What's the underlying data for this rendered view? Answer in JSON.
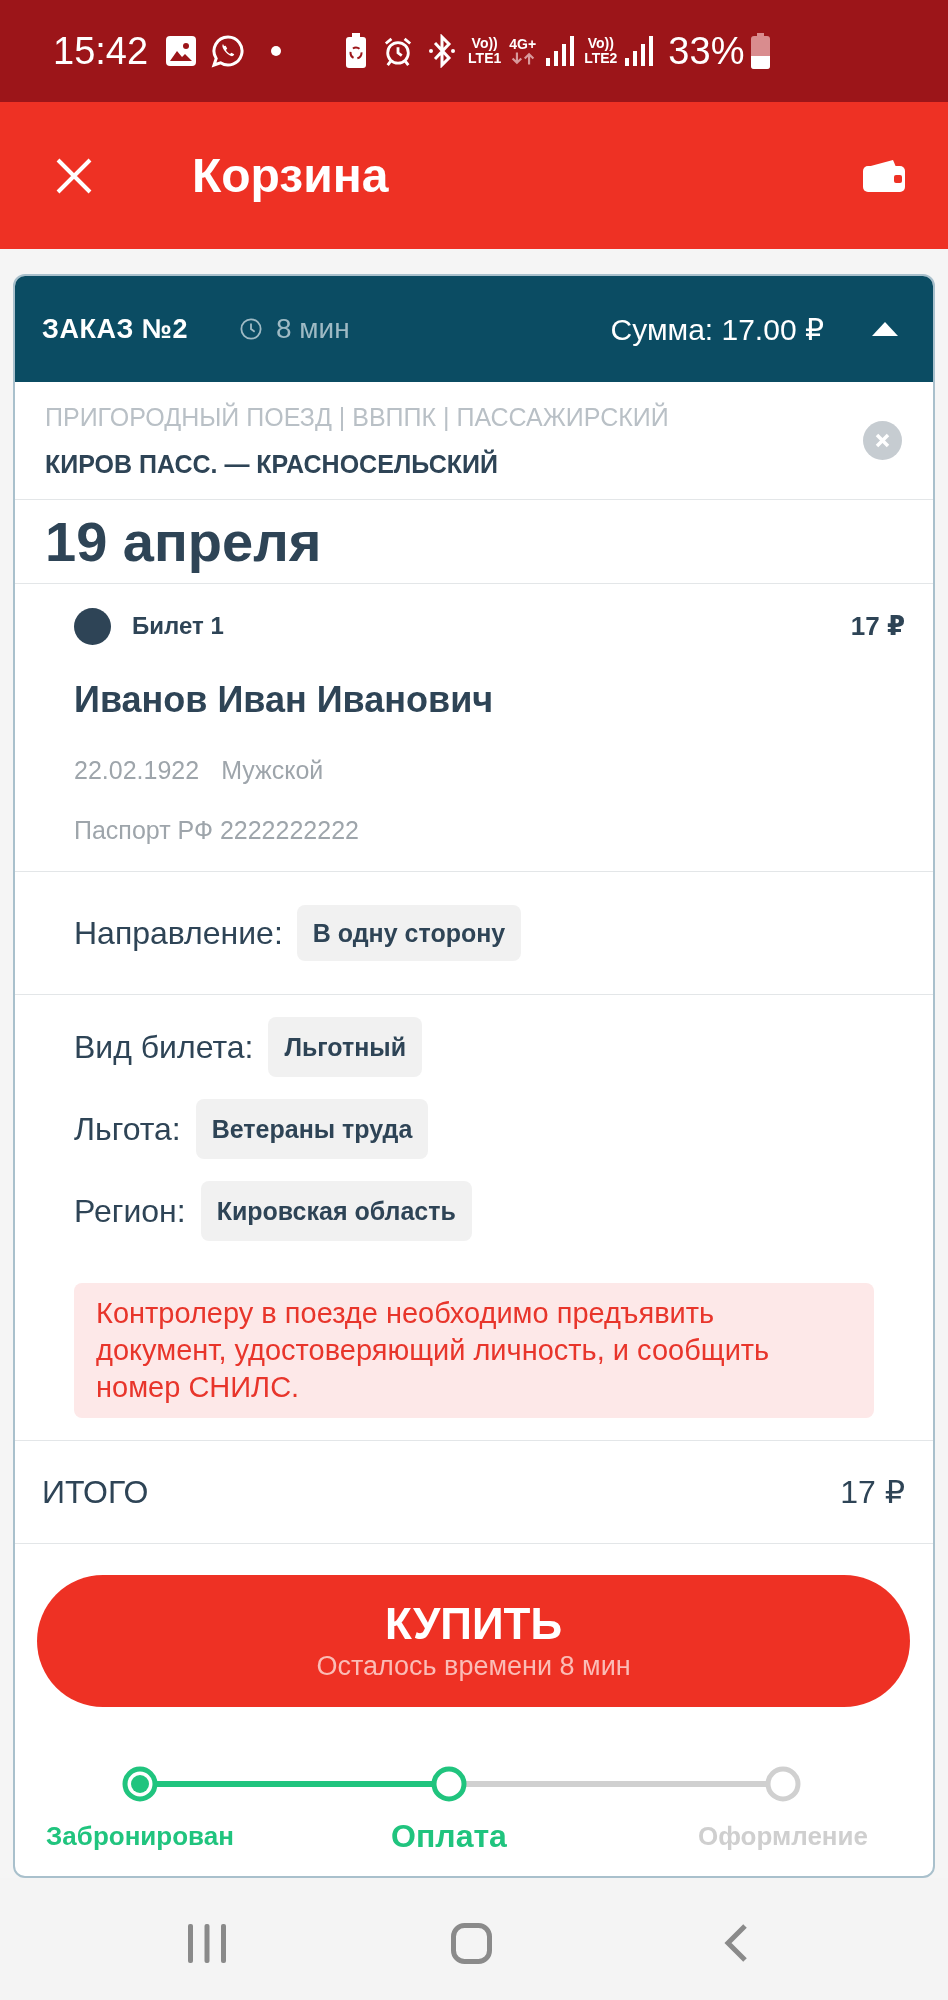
{
  "status_bar": {
    "time": "15:42",
    "sim_1": {
      "voice": "Vo))",
      "network": "LTE1"
    },
    "data_type": "4G+",
    "sim_2": {
      "voice": "Vo))",
      "network": "LTE2"
    },
    "battery": "33%"
  },
  "app_bar": {
    "title": "Корзина"
  },
  "order": {
    "title": "ЗАКАЗ №2",
    "timer": "8 мин",
    "sum": "Сумма: 17.00 ₽",
    "expanded": true
  },
  "trip": {
    "category": "ПРИГОРОДНЫЙ ПОЕЗД | ВВППК | ПАССАЖИРСКИЙ",
    "route": "КИРОВ ПАСС. — КРАСНОСЕЛЬСКИЙ"
  },
  "date": "19 апреля",
  "ticket": {
    "label": "Билет 1",
    "price": "17 ₽",
    "passenger": "Иванов Иван Иванович",
    "birth_date": "22.02.1922",
    "gender": "Мужской",
    "document": "Паспорт РФ 2222222222"
  },
  "direction": {
    "label": "Направление:",
    "value": "В одну сторону"
  },
  "details": [
    {
      "label": "Вид билета:",
      "value": "Льготный"
    },
    {
      "label": "Льгота:",
      "value": "Ветераны труда"
    },
    {
      "label": "Регион:",
      "value": "Кировская область"
    }
  ],
  "notice": "Контролеру в поезде необходимо предъявить документ, удостоверяющий личность, и сообщить номер СНИЛС.",
  "total": {
    "label": "ИТОГО",
    "value": "17 ₽"
  },
  "buy_button": {
    "label": "КУПИТЬ",
    "subtitle": "Осталось времени 8 мин"
  },
  "steps": [
    {
      "label": "Забронирован",
      "completed": true,
      "selected": false
    },
    {
      "label": "Оплата",
      "completed": false,
      "selected": true
    },
    {
      "label": "Оформление",
      "completed": false,
      "selected": false
    }
  ]
}
